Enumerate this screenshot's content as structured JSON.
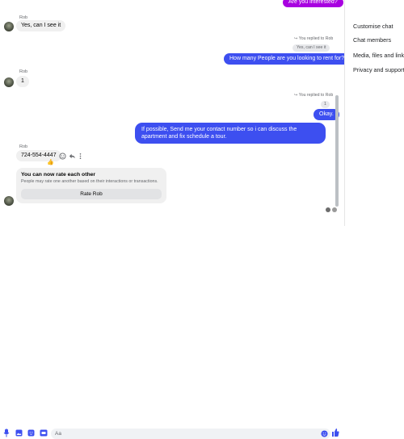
{
  "contact": {
    "name": "Rob"
  },
  "colors": {
    "outgoing": "#3d4ff0",
    "top_message": "#a800e0",
    "incoming": "#f0f0f0"
  },
  "messages": {
    "top_out": "Are you interested?",
    "in1": "Yes, can I see it",
    "replied1": "You replied to Rob",
    "reply_quote1": "Yes, can I see it",
    "out1": "How many People are you looking to rent for?",
    "sender2": "Rob",
    "in2": "1",
    "replied2": "You replied to Rob",
    "reply_quote2": "1",
    "out2": "Okay.",
    "out3": "If possible, Send me your contact number so i can discuss the apartment and fix schedule a tour.",
    "sender3": "Rob",
    "in3": "724-554-4447",
    "reaction": "👍"
  },
  "rating_card": {
    "title": "You can now rate each other",
    "subtitle": "People may rate one another based on their interactions or transactions.",
    "button": "Rate Rob"
  },
  "sidebar": {
    "items": [
      {
        "label": "Customise chat"
      },
      {
        "label": "Chat members"
      },
      {
        "label": "Media, files and links"
      },
      {
        "label": "Privacy and support"
      }
    ]
  },
  "composer": {
    "placeholder": "Aa"
  },
  "icons": [
    "microphone-icon",
    "gallery-icon",
    "sticker-icon",
    "gif-icon",
    "emoji-icon",
    "like-icon",
    "react-icon",
    "reply-icon",
    "more-icon"
  ]
}
